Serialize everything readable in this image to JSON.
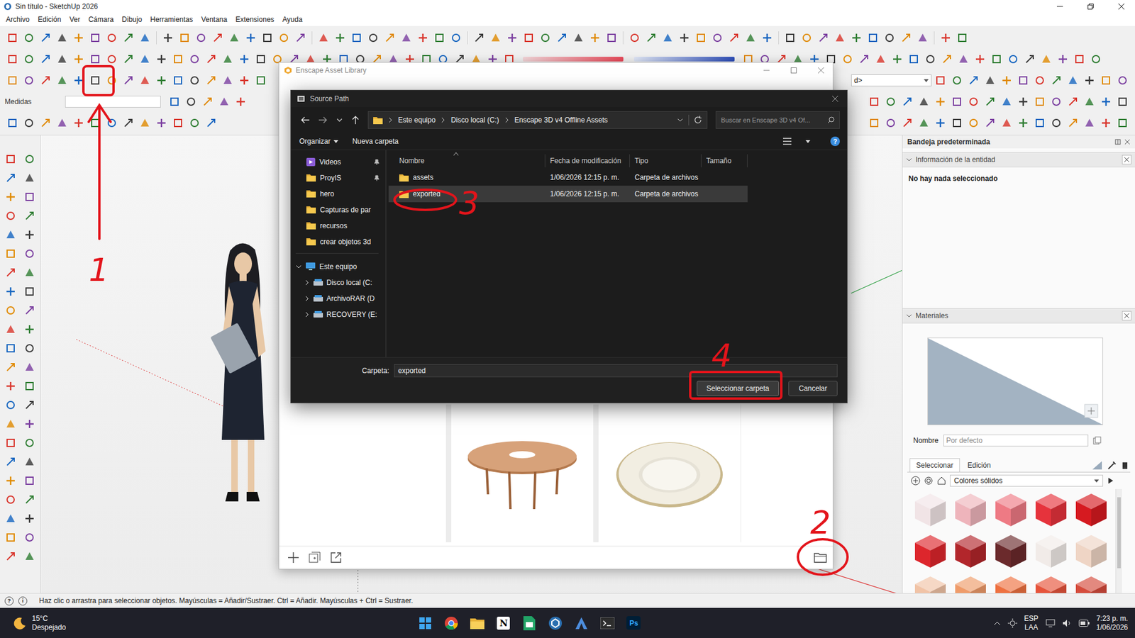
{
  "window": {
    "title": "Sin título - SketchUp 2026"
  },
  "menu": [
    "Archivo",
    "Edición",
    "Ver",
    "Cámara",
    "Dibujo",
    "Herramientas",
    "Ventana",
    "Extensiones",
    "Ayuda"
  ],
  "toolbar": {
    "measurements_label": "Medidas",
    "measurements_value": "",
    "dropdown": "d>"
  },
  "asset_library": {
    "title": "Enscape Asset Library",
    "tiles": [
      {
        "kind": "blank"
      },
      {
        "kind": "table"
      },
      {
        "kind": "plate"
      }
    ]
  },
  "dialog": {
    "title": "Source Path",
    "breadcrumb": [
      "Este equipo",
      "Disco local (C:)",
      "Enscape 3D v4 Offline Assets"
    ],
    "search_placeholder": "Buscar en Enscape 3D v4 Of...",
    "actions": [
      "Organizar",
      "Nueva carpeta"
    ],
    "help": "?",
    "nav": [
      {
        "label": "Videos",
        "kind": "video",
        "pinned": true
      },
      {
        "label": "ProyIS",
        "kind": "folder",
        "pinned": true
      },
      {
        "label": "hero",
        "kind": "folder",
        "pinned": false
      },
      {
        "label": "Capturas de par",
        "kind": "folder",
        "pinned": false
      },
      {
        "label": "recursos",
        "kind": "folder",
        "pinned": false
      },
      {
        "label": "crear objetos 3d",
        "kind": "folder",
        "pinned": false
      },
      {
        "label": "Este equipo",
        "kind": "pc",
        "expanded": true
      },
      {
        "label": "Disco local (C:",
        "kind": "drive",
        "expanded": false
      },
      {
        "label": "ArchivoRAR (D",
        "kind": "drive",
        "expanded": false
      },
      {
        "label": "RECOVERY (E:",
        "kind": "drive",
        "expanded": false
      }
    ],
    "columns": [
      {
        "label": "Nombre",
        "sorted": true
      },
      {
        "label": "Fecha de modificación",
        "sorted": false
      },
      {
        "label": "Tipo",
        "sorted": false
      },
      {
        "label": "Tamaño",
        "sorted": false
      }
    ],
    "rows": [
      {
        "name": "assets",
        "modified": "1/06/2026 12:15 p. m.",
        "type": "Carpeta de archivos",
        "size": "",
        "selected": false
      },
      {
        "name": "exported",
        "modified": "1/06/2026 12:15 p. m.",
        "type": "Carpeta de archivos",
        "size": "",
        "selected": true
      }
    ],
    "folder_label": "Carpeta:",
    "folder_value": "exported",
    "buttons": [
      {
        "label": "Seleccionar carpeta",
        "primary": true
      },
      {
        "label": "Cancelar",
        "primary": false
      }
    ]
  },
  "annotations": [
    {
      "label": "1"
    },
    {
      "label": "2"
    },
    {
      "label": "3"
    },
    {
      "label": "4"
    }
  ],
  "tray": {
    "title": "Bandeja predeterminada",
    "entity_info": {
      "title": "Información de la entidad",
      "expanded": true,
      "message": "No hay nada seleccionado"
    },
    "materials": {
      "title": "Materiales",
      "expanded": true,
      "name_label": "Nombre",
      "name_placeholder": "Por defecto",
      "tabs": [
        {
          "label": "Seleccionar",
          "selected": true
        },
        {
          "label": "Edición",
          "selected": false
        }
      ],
      "library": "Colores sólidos",
      "swatches": [
        {
          "color": "#f1e4e6"
        },
        {
          "color": "#eeb4bb"
        },
        {
          "color": "#ee7a84"
        },
        {
          "color": "#e6333c"
        },
        {
          "color": "#d61a20"
        },
        {
          "color": "#dd262c"
        },
        {
          "color": "#b2262b"
        },
        {
          "color": "#6b2a2c"
        },
        {
          "color": "#f1ebe8"
        },
        {
          "color": "#efd5c5"
        },
        {
          "color": "#f1c3a6"
        },
        {
          "color": "#ef9b69"
        },
        {
          "color": "#ee703f"
        },
        {
          "color": "#e6533a"
        },
        {
          "color": "#d54b3b"
        }
      ]
    }
  },
  "status_bar": {
    "icons": [
      "?",
      "i"
    ],
    "text": "Haz clic o arrastra para seleccionar objetos. Mayúsculas = Añadir/Sustraer. Ctrl = Añadir. Mayúsculas + Ctrl = Sustraer."
  },
  "taskbar": {
    "weather": {
      "temp": "15°C",
      "condition": "Despejado"
    },
    "apps": [
      {
        "kind": "windows"
      },
      {
        "kind": "chrome"
      },
      {
        "kind": "explorer"
      },
      {
        "kind": "notion",
        "label": "N"
      },
      {
        "kind": "sheets"
      },
      {
        "kind": "sketchup"
      },
      {
        "kind": "vector"
      },
      {
        "kind": "terminal"
      },
      {
        "kind": "photoshop",
        "label": "Ps"
      }
    ],
    "language": [
      "ESP",
      "LAA"
    ],
    "time": "7:23 p. m.",
    "date": "1/06/2026"
  }
}
